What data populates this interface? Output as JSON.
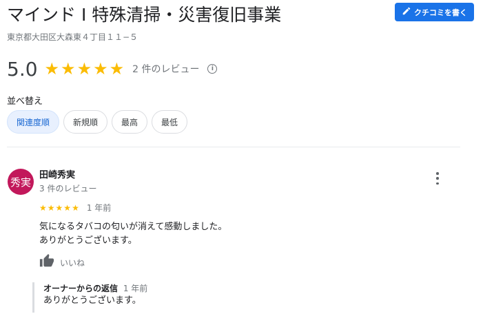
{
  "business": {
    "name": "マインド I 特殊清掃・災害復旧事業",
    "address": "東京都大田区大森東４丁目１１−５"
  },
  "write_review": {
    "label": "クチコミを書く",
    "icon": "pencil-icon"
  },
  "rating": {
    "score": "5.0",
    "stars": 5,
    "review_count": "2 件のレビュー",
    "info_icon": "info-icon"
  },
  "sort": {
    "label": "並べ替え",
    "options": [
      "関連度順",
      "新規順",
      "最高",
      "最低"
    ],
    "selected": "関連度順"
  },
  "review": {
    "avatar_text": "秀実",
    "avatar_color": "#c2185b",
    "reviewer": "田崎秀実",
    "reviewer_reviews": "3 件のレビュー",
    "stars": 5,
    "date": "1 年前",
    "text_line1": "気になるタバコの匂いが消えて感動しました。",
    "text_line2": "ありがとうございます。",
    "like_label": "いいね",
    "more_icon": "more-vert-icon",
    "like_icon": "thumbs-up-icon"
  },
  "owner_reply": {
    "title": "オーナーからの返信",
    "date": "1 年前",
    "text": "ありがとうございます。"
  },
  "colors": {
    "accent": "#1a73e8",
    "star": "#fbbc04",
    "chip_active_bg": "#e8f0fe"
  }
}
